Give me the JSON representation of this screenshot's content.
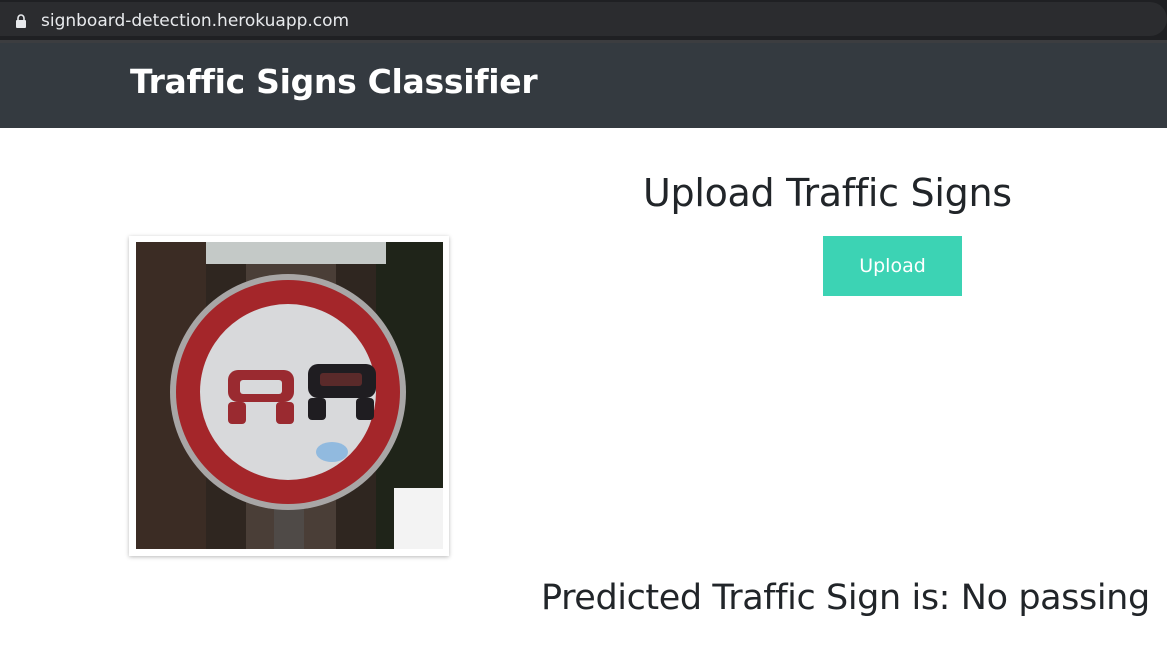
{
  "browser": {
    "url": "signboard-detection.herokuapp.com",
    "lock_icon": "lock-icon"
  },
  "navbar": {
    "brand": "Traffic Signs Classifier",
    "background": "#343a40"
  },
  "main": {
    "heading": "Upload Traffic Signs",
    "upload_button_label": "Upload",
    "upload_button_color": "#3cd3b4",
    "image": {
      "subject": "no-passing-sign",
      "alt": "Traffic sign image"
    },
    "prediction_prefix": "Predicted Traffic Sign is:",
    "prediction_value": "No passing"
  }
}
